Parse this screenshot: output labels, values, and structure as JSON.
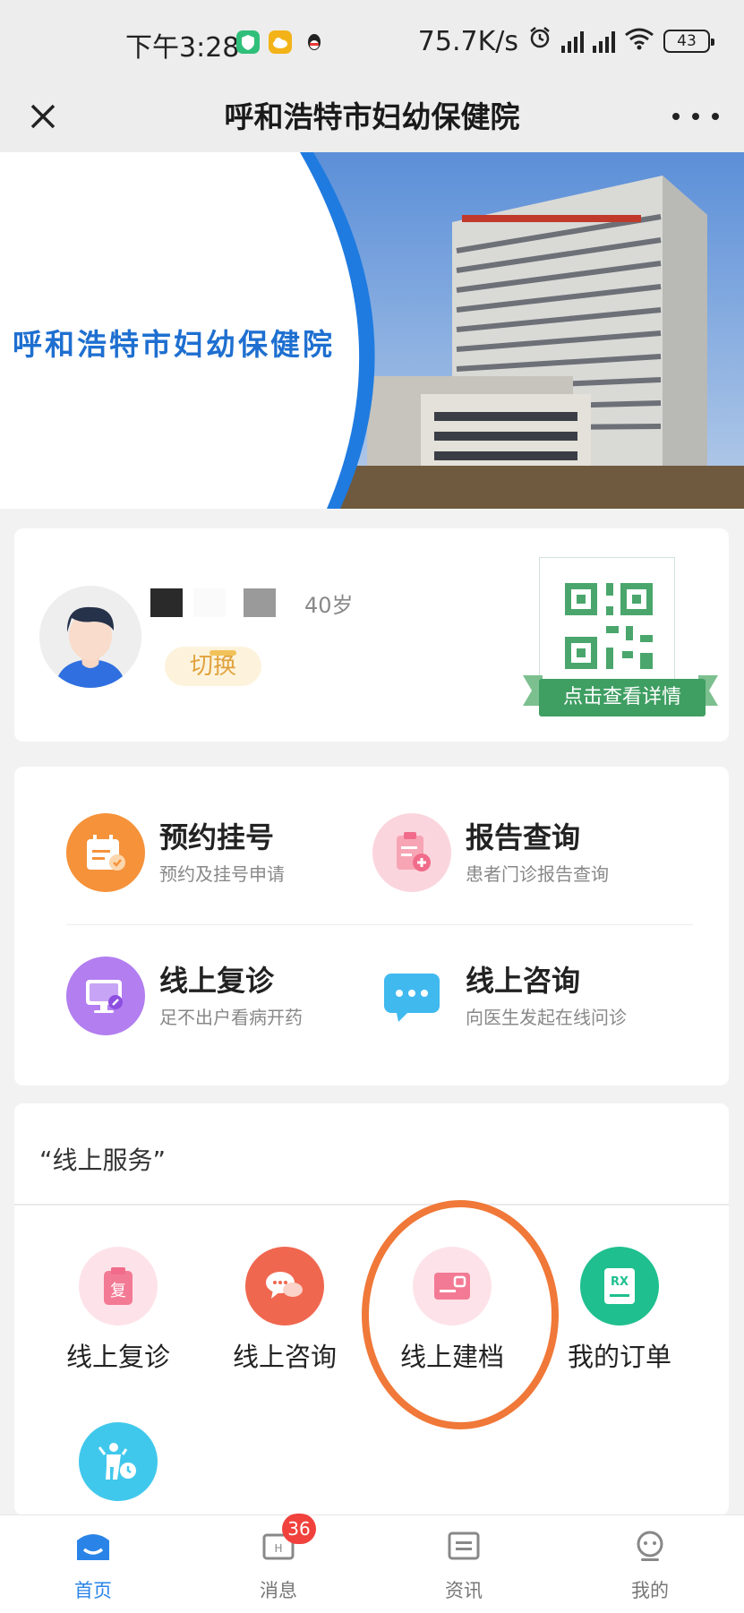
{
  "status_bar": {
    "time": "下午3:28",
    "network_speed": "75.7K/s",
    "battery": "43",
    "icons": [
      "shield-app-icon",
      "cloud-app-icon",
      "qq-icon",
      "alarm-icon",
      "signal-hd-icon",
      "signal-hd-icon",
      "wifi-icon",
      "battery-icon"
    ]
  },
  "title_bar": {
    "title": "呼和浩特市妇幼保健院",
    "close_icon": "close-icon",
    "more_icon": "more-dots-icon"
  },
  "banner": {
    "hospital_name": "呼和浩特市妇幼保健院"
  },
  "profile": {
    "age": "40岁",
    "switch_label": "切换",
    "qr_label": "点击查看详情"
  },
  "services": [
    {
      "title": "预约挂号",
      "subtitle": "预约及挂号申请",
      "icon": "calendar-icon",
      "color": "#f5923a"
    },
    {
      "title": "报告查询",
      "subtitle": "患者门诊报告查询",
      "icon": "report-icon",
      "color": "#f06c8a"
    },
    {
      "title": "线上复诊",
      "subtitle": "足不出户看病开药",
      "icon": "monitor-icon",
      "color": "#a266e8"
    },
    {
      "title": "线上咨询",
      "subtitle": "向医生发起在线问诊",
      "icon": "chat-icon",
      "color": "#3cb8ef"
    }
  ],
  "online_services": {
    "section_title": "“线上服务”",
    "items": [
      {
        "label": "线上复诊",
        "icon": "revisit-icon",
        "color": "#f06c8a"
      },
      {
        "label": "线上咨询",
        "icon": "consult-icon",
        "color": "#f0674f"
      },
      {
        "label": "线上建档",
        "icon": "record-card-icon",
        "color": "#f06c8a"
      },
      {
        "label": "我的订单",
        "icon": "rx-order-icon",
        "color": "#1fbf8f"
      },
      {
        "label": "",
        "icon": "child-clock-icon",
        "color": "#40c8ec"
      }
    ]
  },
  "tab_bar": {
    "tabs": [
      {
        "label": "首页",
        "icon": "home-icon",
        "active": true
      },
      {
        "label": "消息",
        "icon": "message-icon",
        "badge": "36"
      },
      {
        "label": "资讯",
        "icon": "news-icon"
      },
      {
        "label": "我的",
        "icon": "profile-icon"
      }
    ]
  },
  "colors": {
    "accent": "#2a84e8",
    "highlight_ring": "#f07838",
    "qr_green": "#3f9e62",
    "badge_red": "#f0413d"
  }
}
